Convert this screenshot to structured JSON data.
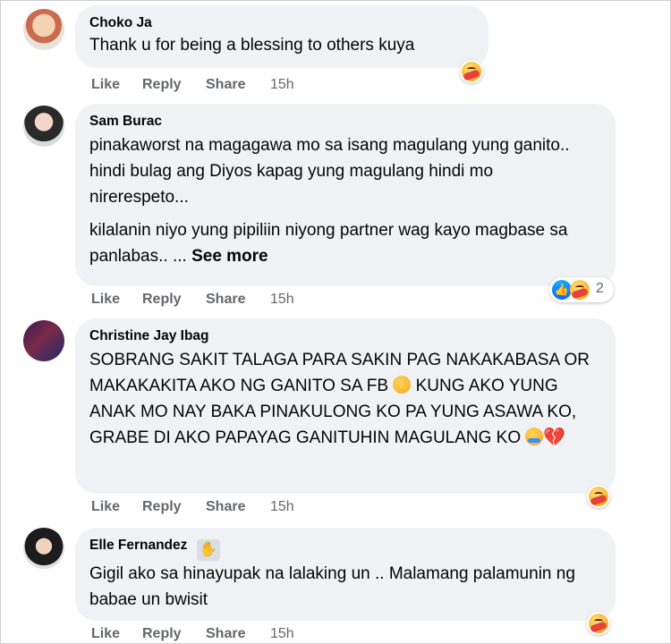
{
  "comments": [
    {
      "author": "Choko Ja",
      "paragraphs": [
        "Thank u for being a blessing to others kuya"
      ],
      "actions": {
        "like": "Like",
        "reply": "Reply",
        "share": "Share",
        "time": "15h"
      }
    },
    {
      "author": "Sam Burac",
      "paragraphs": [
        "pinakaworst na magagawa mo sa isang magulang yung ganito.. hindi bulag ang Diyos kapag yung magulang hindi mo nirerespeto...",
        "kilalanin niyo yung pipiliin niyong partner wag kayo magbase sa panlabas.. ..."
      ],
      "see_more": "See more",
      "reaction_count": "2",
      "actions": {
        "like": "Like",
        "reply": "Reply",
        "share": "Share",
        "time": "15h"
      }
    },
    {
      "author": "Christine Jay Ibag",
      "paragraphs": [
        "SOBRANG SAKIT TALAGA PARA SAKIN PAG NAKAKABASA OR MAKAKAKITA AKO NG GANITO SA FB",
        "KUNG AKO YUNG ANAK MO NAY BAKA PINAKULONG KO PA YUNG ASAWA KO, GRABE DI AKO PAPAYAG GANITUHIN MAGULANG KO"
      ],
      "actions": {
        "like": "Like",
        "reply": "Reply",
        "share": "Share",
        "time": "15h"
      }
    },
    {
      "author": "Elle Fernandez",
      "paragraphs": [
        "Gigil ako sa hinayupak na lalaking un .. Malamang palamunin ng babae un bwisit"
      ],
      "badge_icon": "waving-hand-icon",
      "actions": {
        "like": "Like",
        "reply": "Reply",
        "share": "Share",
        "time": "15h"
      }
    }
  ],
  "icons": {
    "reaction_care": "care-reaction-icon",
    "reaction_like": "like-reaction-icon",
    "inline_emojis": [
      "sad-face-emoji",
      "crying-face-emoji",
      "broken-heart-emoji"
    ]
  },
  "colors": {
    "bubble_bg": "#f0f2f5",
    "meta_text": "#65676b",
    "like_blue": "#0866ff",
    "heart_red": "#e2384d"
  }
}
